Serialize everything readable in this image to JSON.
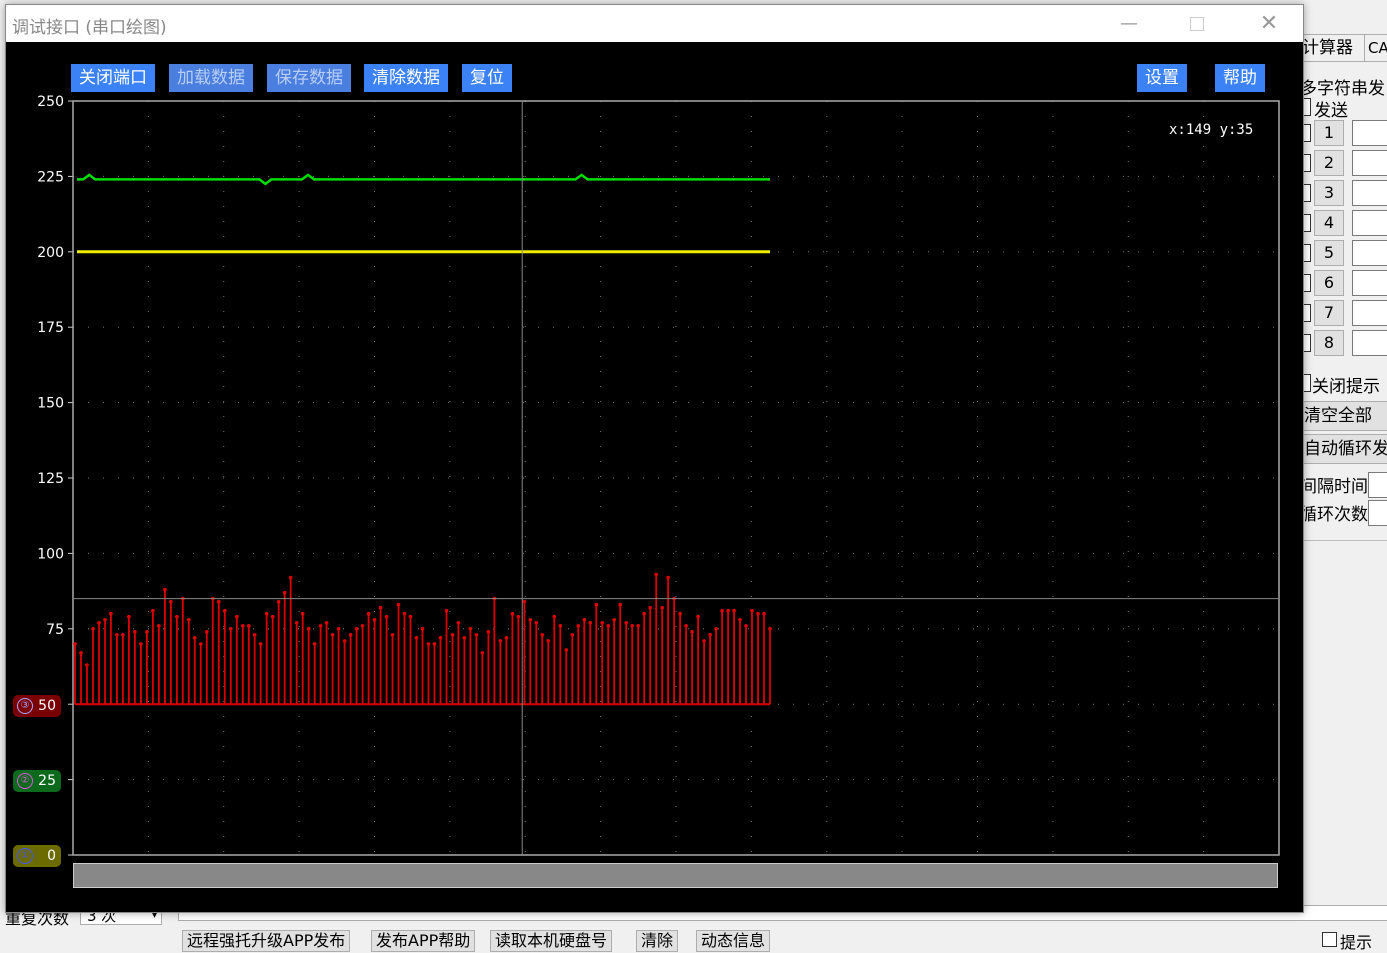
{
  "dialog": {
    "title": "调试接口 (串口绘图)",
    "toolbar": {
      "close_port": "关闭端口",
      "load_data": "加载数据",
      "save_data": "保存数据",
      "clear_data": "清除数据",
      "reset": "复位",
      "settings": "设置",
      "help": "帮助"
    },
    "cursor_readout": "x:149 y:35",
    "channels": [
      {
        "index": "③",
        "value": "50",
        "color": "#ff0000"
      },
      {
        "index": "②",
        "value": "25",
        "color": "#cc44cc"
      },
      {
        "index": "①",
        "value": "0",
        "color": "#3344ff"
      }
    ]
  },
  "chart_data": {
    "type": "line",
    "y_ticks": [
      "250",
      "225",
      "200",
      "175",
      "150",
      "125",
      "100",
      "75",
      "50",
      "25",
      "0"
    ],
    "ylim": [
      0,
      250
    ],
    "xlim": [
      0,
      400
    ],
    "cursor": {
      "x": 149,
      "y": 35
    },
    "series": [
      {
        "color": "#00dd00",
        "values_desc": "steady ~224",
        "base": 224
      },
      {
        "color": "#eeee00",
        "base": 200
      },
      {
        "color": "#dd0000",
        "base": 50,
        "values": [
          70,
          67,
          63,
          75,
          77,
          78,
          80,
          73,
          73,
          79,
          74,
          70,
          74,
          81,
          76,
          88,
          84,
          79,
          85,
          78,
          72,
          70,
          74,
          85,
          84,
          81,
          75,
          79,
          76,
          76,
          73,
          70,
          80,
          79,
          84,
          87,
          92,
          77,
          80,
          75,
          70,
          76,
          77,
          73,
          75,
          71,
          73,
          75,
          76,
          80,
          78,
          82,
          79,
          73,
          83,
          80,
          79,
          72,
          75,
          70,
          70,
          72,
          81,
          73,
          77,
          72,
          75,
          73,
          67,
          74,
          85,
          71,
          72,
          80,
          79,
          84,
          78,
          77,
          73,
          71,
          79,
          76,
          68,
          73,
          76,
          78,
          77,
          83,
          77,
          76,
          78,
          83,
          77,
          76,
          76,
          80,
          82,
          93,
          82,
          92,
          85,
          80,
          76,
          74,
          79,
          71,
          73,
          75,
          81,
          81,
          81,
          78,
          76,
          81,
          80,
          80,
          75
        ]
      }
    ]
  },
  "right_panel": {
    "tabs": [
      "计算器",
      "CA"
    ],
    "heading": "多字符串发",
    "send_label": "发送",
    "rows": [
      "1",
      "2",
      "3",
      "4",
      "5",
      "6",
      "7",
      "8"
    ],
    "close_hint": "关闭提示",
    "clear_all": "清空全部",
    "auto_loop": "自动循环发",
    "interval_label": "间隔时间",
    "loop_count_label": "循环次数"
  },
  "bottom_bar": {
    "repeat_label": "重复次数",
    "repeat_value": "3 次",
    "buttons": [
      "远程强托升级APP发布",
      "发布APP帮助",
      "读取本机硬盘号",
      "清除",
      "动态信息"
    ],
    "hint_check": "提示"
  }
}
